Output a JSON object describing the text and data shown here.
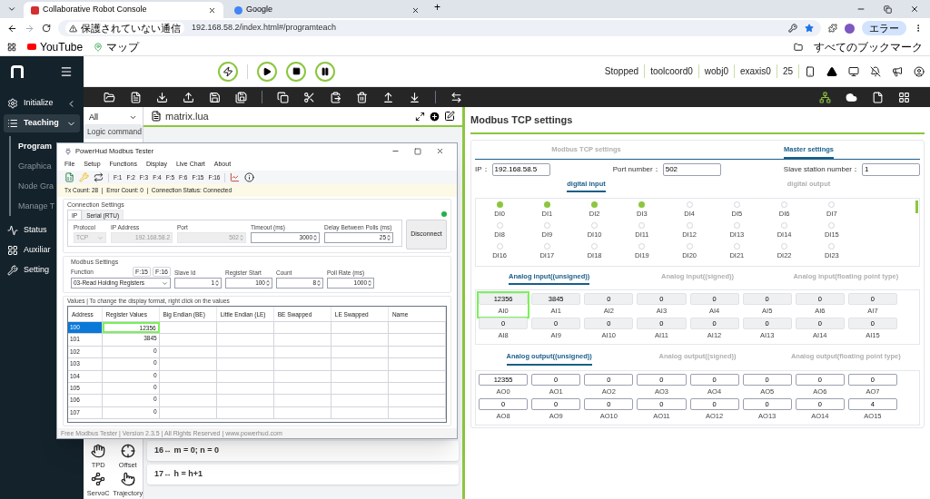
{
  "browser": {
    "tabs": [
      {
        "title": "Collaborative Robot Console",
        "selected": true
      },
      {
        "title": "Google",
        "selected": false
      }
    ],
    "new_tab": "+",
    "security": "保護されていない通信",
    "url": "192.168.58.2/index.html#/programteach",
    "profile": "エラー",
    "bookmarks": [
      {
        "label": "YouTube",
        "kind": "youtube"
      },
      {
        "label": "マップ",
        "kind": "maps"
      }
    ],
    "all_bookmarks": "すべてのブックマーク"
  },
  "sidebar": {
    "items": [
      {
        "label": "Initialize",
        "kind": "gear",
        "expanded": false,
        "selected": false
      },
      {
        "label": "Teaching",
        "kind": "list",
        "expanded": true,
        "selected": true,
        "children": [
          {
            "label": "Program",
            "selected": true
          },
          {
            "label": "Graphica",
            "selected": false
          },
          {
            "label": "Node Gra",
            "selected": false
          },
          {
            "label": "Manage T",
            "selected": false
          }
        ]
      },
      {
        "label": "Status",
        "kind": "pulse",
        "selected": false
      },
      {
        "label": "Auxiliar",
        "kind": "grid",
        "selected": false
      },
      {
        "label": "Setting",
        "kind": "tools",
        "selected": false
      }
    ]
  },
  "topbar": {
    "controls": [
      {
        "kind": "lightning"
      },
      {
        "kind": "play"
      },
      {
        "kind": "stop"
      },
      {
        "kind": "pause"
      }
    ],
    "status": [
      "Stopped",
      "toolcoord0",
      "wobj0",
      "exaxis0",
      "25"
    ]
  },
  "commands": {
    "filter": "All",
    "category": "Logic command",
    "items": [
      {
        "label": "TPD",
        "kind": "hand"
      },
      {
        "label": "Offset",
        "kind": "offset"
      },
      {
        "label": "ServoC",
        "kind": "servo"
      },
      {
        "label": "Trajectory",
        "kind": "pointer"
      }
    ]
  },
  "editor": {
    "file": "matrix.lua",
    "lines": [
      "16↔ m = 0; n = 0",
      "17↔ h = h+1"
    ]
  },
  "modbus_tester": {
    "title": "PowerHud Modbus Tester",
    "menu": [
      "File",
      "Setup",
      "Functions",
      "Display",
      "Live Chart",
      "About"
    ],
    "function_buttons": [
      "F:1",
      "F:2",
      "F:3",
      "F:4",
      "F:5",
      "F:6",
      "F:15",
      "F:16"
    ],
    "status": "Tx Count: 28  |  Error Count: 0  |  Connection Status: Connected",
    "connection": {
      "title": "Connection Settings",
      "connected": true,
      "tabs": [
        {
          "label": "IP",
          "selected": true
        },
        {
          "label": "Serial (RTU)",
          "selected": false
        }
      ],
      "fields": [
        {
          "label": "Protocol",
          "value": "TCP",
          "kind": "select",
          "disabled": true
        },
        {
          "label": "IP Address",
          "value": "192.168.58.2",
          "kind": "text",
          "disabled": true
        },
        {
          "label": "Port",
          "value": "502",
          "kind": "spin",
          "disabled": true
        },
        {
          "label": "Timeout (ms)",
          "value": "3000",
          "kind": "spin",
          "disabled": false
        },
        {
          "label": "Delay Between Polls (ms)",
          "value": "25",
          "kind": "spin",
          "disabled": false
        }
      ],
      "button": "Disconnect"
    },
    "settings": {
      "title": "Modbus Settings",
      "function_label": "Function",
      "function": "03-Read Holding Registers",
      "buttons": [
        "F:15",
        "F:16"
      ],
      "fields": [
        {
          "label": "Slave Id",
          "value": "1"
        },
        {
          "label": "Register Start",
          "value": "100"
        },
        {
          "label": "Count",
          "value": "8"
        },
        {
          "label": "Poll Rate (ms)",
          "value": "1000"
        }
      ]
    },
    "values_title": "Values | To change the display format, right click on the values",
    "table": {
      "columns": [
        "Address",
        "Register Values",
        "Big Endian (BE)",
        "Little Endian (LE)",
        "BE Swapped",
        "LE Swapped",
        "Name"
      ],
      "rows": [
        {
          "address": "100",
          "value": "12356",
          "selected": true,
          "highlighted": true
        },
        {
          "address": "101",
          "value": "3845",
          "selected": false,
          "highlighted": false
        },
        {
          "address": "102",
          "value": "0",
          "selected": false,
          "highlighted": false
        },
        {
          "address": "103",
          "value": "0",
          "selected": false,
          "highlighted": false
        },
        {
          "address": "104",
          "value": "0",
          "selected": false,
          "highlighted": false
        },
        {
          "address": "105",
          "value": "0",
          "selected": false,
          "highlighted": false
        },
        {
          "address": "106",
          "value": "0",
          "selected": false,
          "highlighted": false
        },
        {
          "address": "107",
          "value": "0",
          "selected": false,
          "highlighted": false
        }
      ]
    },
    "footer": "Free Modbus Tester | Version 2.3.5 | All Rights Reserved | www.powerhud.com"
  },
  "modbus_tcp": {
    "title": "Modbus TCP settings",
    "tabs": [
      {
        "label": "Modbus TCP settings",
        "selected": false
      },
      {
        "label": "Master settings",
        "selected": true
      }
    ],
    "fields": [
      {
        "label": "IP：",
        "value": "192.168.58.5"
      },
      {
        "label": "Port number：",
        "value": "502"
      },
      {
        "label": "Slave station number：",
        "value": "1"
      }
    ],
    "digital_tabs": [
      {
        "label": "digital input",
        "selected": true
      },
      {
        "label": "digital output",
        "selected": false
      }
    ],
    "digital_inputs": [
      {
        "label": "DI0",
        "on": true
      },
      {
        "label": "DI1",
        "on": true
      },
      {
        "label": "DI2",
        "on": true
      },
      {
        "label": "DI3",
        "on": true
      },
      {
        "label": "DI4",
        "on": false
      },
      {
        "label": "DI5",
        "on": false
      },
      {
        "label": "DI6",
        "on": false
      },
      {
        "label": "DI7",
        "on": false
      },
      {
        "label": "DI8",
        "on": false
      },
      {
        "label": "DI9",
        "on": false
      },
      {
        "label": "DI10",
        "on": false
      },
      {
        "label": "DI11",
        "on": false
      },
      {
        "label": "DI12",
        "on": false
      },
      {
        "label": "DI13",
        "on": false
      },
      {
        "label": "DI14",
        "on": false
      },
      {
        "label": "DI15",
        "on": false
      },
      {
        "label": "DI16",
        "on": false
      },
      {
        "label": "DI17",
        "on": false
      },
      {
        "label": "DI18",
        "on": false
      },
      {
        "label": "DI19",
        "on": false
      },
      {
        "label": "DI20",
        "on": false
      },
      {
        "label": "DI21",
        "on": false
      },
      {
        "label": "DI22",
        "on": false
      },
      {
        "label": "DI23",
        "on": false
      }
    ],
    "analog_input_tabs": [
      {
        "label": "Analog input((unsigned))",
        "selected": true
      },
      {
        "label": "Analog input((signed))",
        "selected": false
      },
      {
        "label": "Analog input(floating point type)",
        "selected": false
      }
    ],
    "analog_inputs": [
      {
        "label": "AI0",
        "value": "12356",
        "highlighted": true
      },
      {
        "label": "AI1",
        "value": "3845",
        "highlighted": false
      },
      {
        "label": "AI2",
        "value": "0",
        "highlighted": false
      },
      {
        "label": "AI3",
        "value": "0",
        "highlighted": false
      },
      {
        "label": "AI4",
        "value": "0",
        "highlighted": false
      },
      {
        "label": "AI5",
        "value": "0",
        "highlighted": false
      },
      {
        "label": "AI6",
        "value": "0",
        "highlighted": false
      },
      {
        "label": "AI7",
        "value": "0",
        "highlighted": false
      },
      {
        "label": "AI8",
        "value": "0",
        "highlighted": false
      },
      {
        "label": "AI9",
        "value": "0",
        "highlighted": false
      },
      {
        "label": "AI10",
        "value": "0",
        "highlighted": false
      },
      {
        "label": "AI11",
        "value": "0",
        "highlighted": false
      },
      {
        "label": "AI12",
        "value": "0",
        "highlighted": false
      },
      {
        "label": "AI13",
        "value": "0",
        "highlighted": false
      },
      {
        "label": "AI14",
        "value": "0",
        "highlighted": false
      },
      {
        "label": "AI15",
        "value": "0",
        "highlighted": false
      }
    ],
    "analog_output_tabs": [
      {
        "label": "Analog output((unsigned))",
        "selected": true
      },
      {
        "label": "Analog output((signed))",
        "selected": false
      },
      {
        "label": "Analog output(floating point type)",
        "selected": false
      }
    ],
    "analog_outputs": [
      {
        "label": "AO0",
        "value": "12355"
      },
      {
        "label": "AO1",
        "value": "0"
      },
      {
        "label": "AO2",
        "value": "0"
      },
      {
        "label": "AO3",
        "value": "0"
      },
      {
        "label": "AO4",
        "value": "0"
      },
      {
        "label": "AO5",
        "value": "0"
      },
      {
        "label": "AO6",
        "value": "0"
      },
      {
        "label": "AO7",
        "value": "0"
      },
      {
        "label": "AO8",
        "value": "0"
      },
      {
        "label": "AO9",
        "value": "0"
      },
      {
        "label": "AO10",
        "value": "0"
      },
      {
        "label": "AO11",
        "value": "0"
      },
      {
        "label": "AO12",
        "value": "0"
      },
      {
        "label": "AO13",
        "value": "0"
      },
      {
        "label": "AO14",
        "value": "0"
      },
      {
        "label": "AO15",
        "value": "4"
      }
    ]
  }
}
